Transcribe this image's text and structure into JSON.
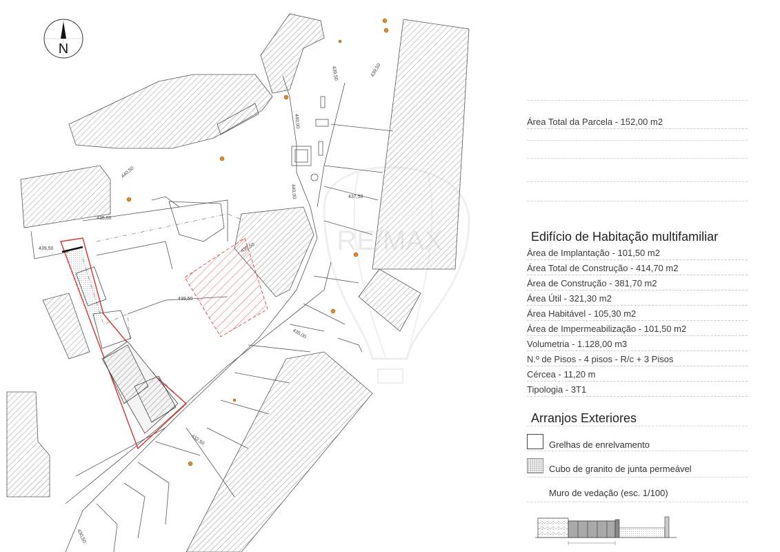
{
  "compass": {
    "north_label": "N"
  },
  "plan": {
    "contour_labels": [
      "439,50",
      "440,00",
      "440,50",
      "440,00",
      "439,50",
      "437,50",
      "435,00",
      "439,50",
      "439,50",
      "435,00",
      "432,50",
      "430,50",
      "439,50"
    ],
    "watermark_text": "RE/MAX"
  },
  "legend": {
    "parcel_area": "Área Total da Parcela - 152,00 m2",
    "building_title": "Edifício de Habitação multifamiliar",
    "rows": [
      "Área de Implantação -  101,50 m2",
      "Área Total de Construção -  414,70 m2",
      "Área de Construção -  381,70 m2",
      "Área Útil -  321,30 m2",
      "Área Habitável -  105,30 m2",
      "Área de Impermeabilização -  101,50 m2",
      "Volumetria -  1.128,00 m3",
      "N.º de Pisos - 4 pisos - R/c + 3 Pisos",
      "Cércea - 11,20 m",
      "Tipologia - 3T1"
    ],
    "exterior_title": "Arranjos Exteriores",
    "exterior_items": [
      "Grelhas de enrelvamento",
      "Cubo de granito de junta permeável"
    ],
    "wall_label": "Muro de vedação (esc. 1/100)"
  },
  "colors": {
    "line": "#555555",
    "parcel": "#d9302b",
    "marker": "#e08a2a",
    "hatch": "#666666"
  }
}
